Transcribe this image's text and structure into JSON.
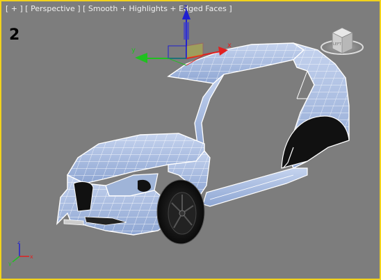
{
  "viewport": {
    "label_parts": [
      "[ + ]",
      "[ Perspective ]",
      "[ Smooth + Highlights + Edged Faces ]"
    ],
    "number": "2",
    "border_color": "#f2d31b",
    "background_color": "#7d7d7d"
  },
  "gizmo": {
    "x_axis_label": "x",
    "y_axis_label": "y",
    "z_axis_label": "z",
    "x_color": "#e02020",
    "y_color": "#20c020",
    "z_color": "#2020d0"
  },
  "viewcube": {
    "face_label": "LEFT"
  },
  "tripod": {
    "x_label": "x",
    "y_label": "y",
    "z_label": "z"
  },
  "model": {
    "mesh_color": "#a9bee0",
    "wire_color": "#ffffff"
  }
}
